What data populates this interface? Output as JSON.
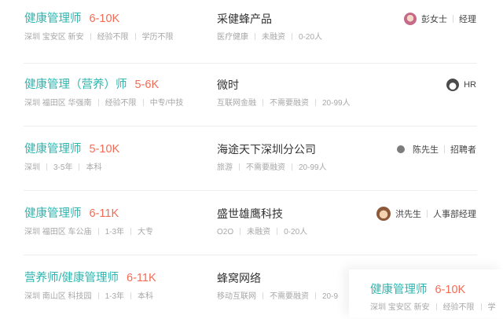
{
  "jobs": [
    {
      "title": "健康管理师",
      "salary": "6-10K",
      "location": "深圳 宝安区 新安",
      "experience": "经验不限",
      "education": "学历不限",
      "company": "采健蜂产品",
      "industry": "医疗健康",
      "funding": "未融资",
      "size": "0-20人",
      "contact_name": "彭女士",
      "contact_role": "经理",
      "avatar": "female-avatar-icon"
    },
    {
      "title": "健康管理（营养）师",
      "salary": "5-6K",
      "location": "深圳 福田区 华强南",
      "experience": "经验不限",
      "education": "中专/中技",
      "company": "微时",
      "industry": "互联网金融",
      "funding": "不需要融资",
      "size": "20-99人",
      "contact_name": "",
      "contact_role": "HR",
      "avatar": "cartoon-avatar-icon"
    },
    {
      "title": "健康管理师",
      "salary": "5-10K",
      "location": "深圳",
      "experience": "3-5年",
      "education": "本科",
      "company": "海途天下深圳分公司",
      "industry": "旅游",
      "funding": "不需要融资",
      "size": "20-99人",
      "contact_name": "陈先生",
      "contact_role": "招聘者",
      "avatar": "user-silhouette-icon"
    },
    {
      "title": "健康管理师",
      "salary": "6-11K",
      "location": "深圳 福田区 车公庙",
      "experience": "1-3年",
      "education": "大专",
      "company": "盛世雄鹰科技",
      "industry": "O2O",
      "funding": "未融资",
      "size": "0-20人",
      "contact_name": "洪先生",
      "contact_role": "人事部经理",
      "avatar": "male-avatar-icon"
    },
    {
      "title": "营养师/健康管理师",
      "salary": "6-11K",
      "location": "深圳 南山区 科技园",
      "experience": "1-3年",
      "education": "本科",
      "company": "蜂窝网络",
      "industry": "移动互联网",
      "funding": "不需要融资",
      "size": "20-9"
    }
  ],
  "overlay": {
    "title": "健康管理师",
    "salary": "6-10K",
    "location": "深圳 宝安区 新安",
    "experience": "经验不限",
    "education": "学"
  },
  "colors": {
    "title": "#2fb6b0",
    "salary": "#f46b55",
    "meta": "#a7a7a7",
    "company": "#333333"
  }
}
